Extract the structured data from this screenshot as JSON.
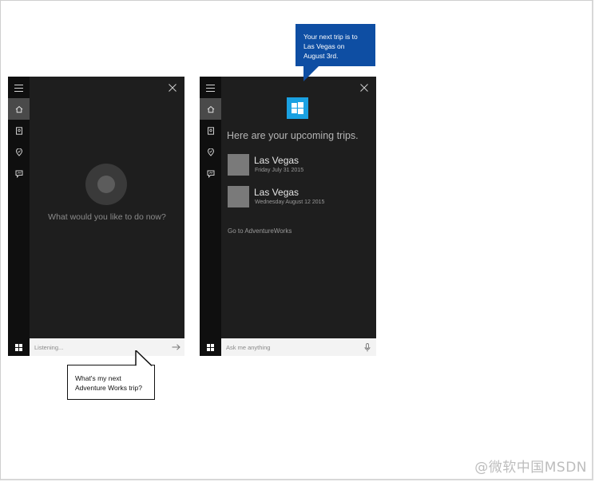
{
  "left_panel": {
    "prompt": "What would you like to do now?",
    "search_text": "Listening..."
  },
  "right_panel": {
    "heading": "Here are your upcoming trips.",
    "trips": [
      {
        "title": "Las Vegas",
        "date": "Friday July 31 2015"
      },
      {
        "title": "Las Vegas",
        "date": "Wednesday August 12 2015"
      }
    ],
    "link": "Go to AdventureWorks",
    "search_placeholder": "Ask me anything"
  },
  "callouts": {
    "cortana_response": [
      "Your next trip is to",
      "Las Vegas on",
      "August 3rd."
    ],
    "user_query": [
      "What's my next",
      "Adventure Works trip?"
    ]
  },
  "watermark": "@微软中国MSDN",
  "colors": {
    "panel_bg": "#1e1e1e",
    "rail_bg": "#0f0f0f",
    "accent_blue": "#1aa1e2",
    "callout_blue": "#0e4ea3"
  },
  "icons": [
    "hamburger-icon",
    "home-icon",
    "notebook-icon",
    "location-icon",
    "feedback-icon",
    "close-icon",
    "windows-logo-icon",
    "arrow-right-icon",
    "microphone-icon"
  ]
}
